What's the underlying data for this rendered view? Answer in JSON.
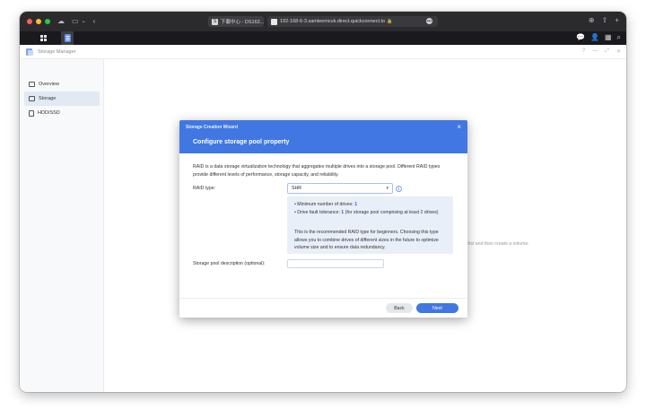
{
  "browser": {
    "tab1_title": "下載中心 - DS162...",
    "tab1_favicon": "S",
    "url": "192-168-6-3.samleemcuk.direct.quickconnect.to",
    "icons": [
      "sidebar-icon",
      "chevron-down-icon",
      "back-arrow-icon",
      "lock-icon",
      "download-icon",
      "share-icon",
      "new-tab-icon"
    ]
  },
  "app": {
    "title": "Storage Manager",
    "window_controls": [
      "?",
      "—",
      "⤢",
      "✕"
    ]
  },
  "sidebar": {
    "items": [
      {
        "label": "Overview",
        "active": false
      },
      {
        "label": "Storage",
        "active": true
      },
      {
        "label": "HDD/SSD",
        "active": false
      }
    ]
  },
  "main": {
    "hint": "first and then create a volume."
  },
  "dialog": {
    "wizard_title": "Storage Creation Wizard",
    "title": "Configure storage pool property",
    "description": "RAID is a data storage virtualization technology that aggregates multiple drives into a storage pool. Different RAID types provide different levels of performance, storage capacity, and reliability.",
    "raid_label": "RAID type:",
    "raid_value": "SHR",
    "info": {
      "min_drives_label": "Minimum number of drives:",
      "min_drives_value": "1",
      "fault_label": "Drive fault tolerance:",
      "fault_value": "1",
      "fault_note": "(for storage pool comprising at least 2 drives)",
      "recommend": "This is the recommended RAID type for beginners. Choosing this type allows you to combine drives of different sizes in the future to optimize volume size and to ensure data redundancy."
    },
    "desc_label": "Storage pool description (optional):",
    "desc_value": "",
    "back_label": "Back",
    "next_label": "Next"
  },
  "colors": {
    "accent": "#4177e2",
    "dsm_bar": "#1a1a1e",
    "browser_bar": "#2b2b2e"
  }
}
